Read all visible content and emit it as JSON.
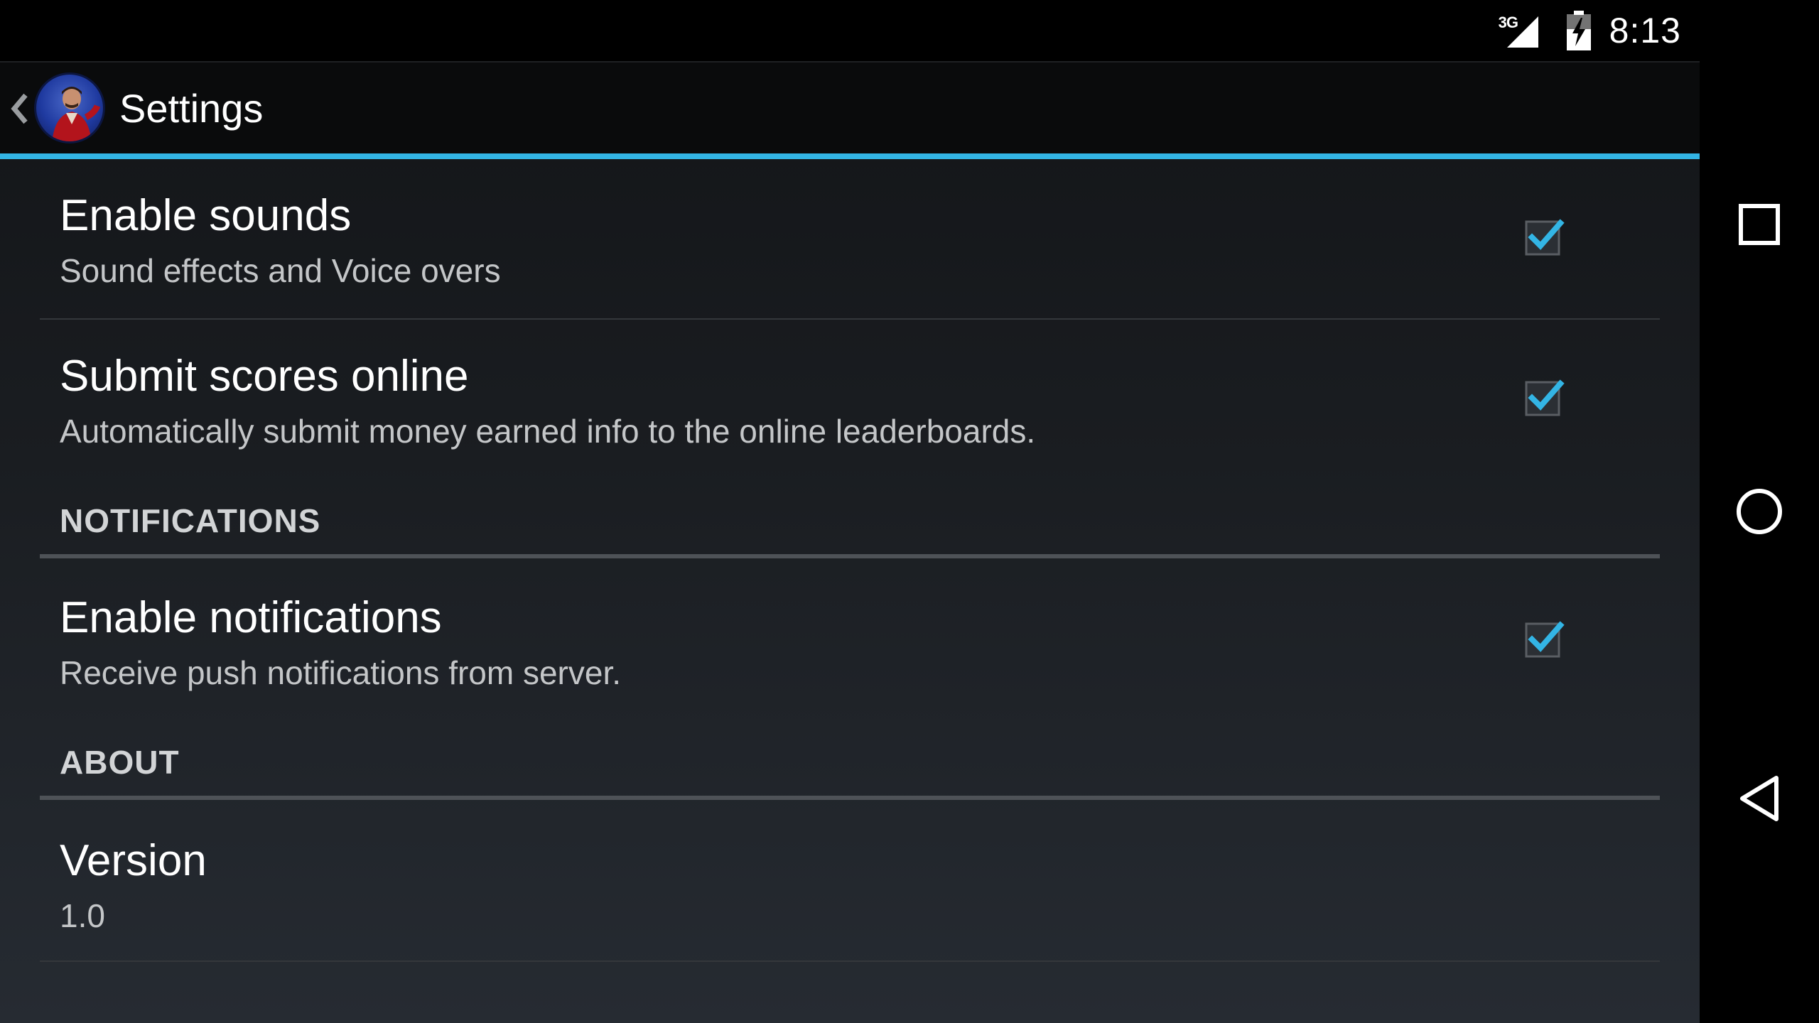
{
  "status_bar": {
    "network_type": "3G",
    "time": "8:13"
  },
  "action_bar": {
    "title": "Settings",
    "accent_color": "#33b5e5"
  },
  "preferences": [
    {
      "title": "Enable sounds",
      "summary": "Sound effects and Voice overs",
      "checked": true
    },
    {
      "title": "Submit scores online",
      "summary": "Automatically submit money earned info to the online leaderboards.",
      "checked": true
    }
  ],
  "sections": {
    "notifications": {
      "header": "NOTIFICATIONS",
      "items": [
        {
          "title": "Enable notifications",
          "summary": "Receive push notifications from server.",
          "checked": true
        }
      ]
    },
    "about": {
      "header": "ABOUT",
      "items": [
        {
          "title": "Version",
          "summary": "1.0"
        }
      ]
    }
  },
  "nav_bar": {
    "icons": [
      "recent-apps-icon",
      "home-icon",
      "back-icon"
    ]
  }
}
